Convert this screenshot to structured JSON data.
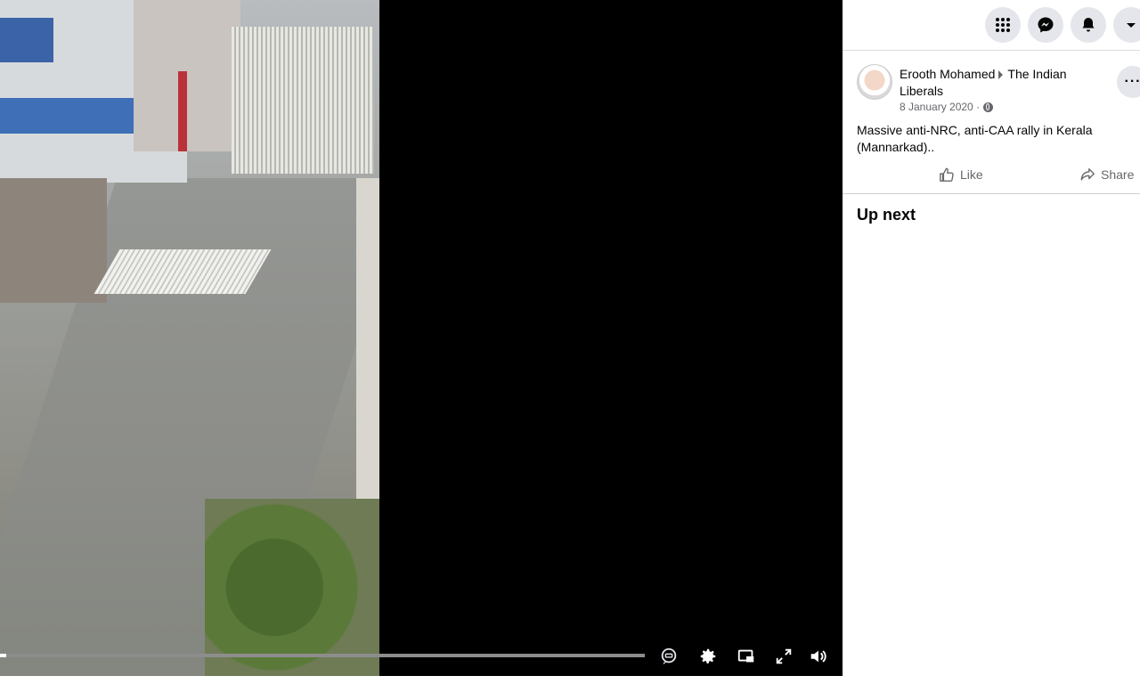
{
  "video": {
    "progress_fraction": 0.01,
    "controls": {
      "transcript_icon": "captions-icon",
      "settings_icon": "gear-icon",
      "pip_icon": "picture-in-picture-icon",
      "fullscreen_icon": "fullscreen-icon",
      "volume_icon": "speaker-icon"
    }
  },
  "topbar": {
    "buttons": [
      "menu-grid-icon",
      "messenger-icon",
      "bell-icon",
      "chevron-down-icon"
    ]
  },
  "post": {
    "author": "Erooth Mohamed",
    "group": "The Indian Liberals",
    "date": "8 January 2020 ·",
    "text": "Massive anti-NRC, anti-CAA rally in Kerala (Mannarkad)..",
    "more_label": "···",
    "like_label": "Like",
    "share_label": "Share"
  },
  "sidebar": {
    "up_next_label": "Up next"
  },
  "colors": {
    "panel_bg": "#ffffff",
    "button_bg": "#e4e6eb",
    "secondary_text": "#65676b",
    "primary_text": "#050505"
  }
}
